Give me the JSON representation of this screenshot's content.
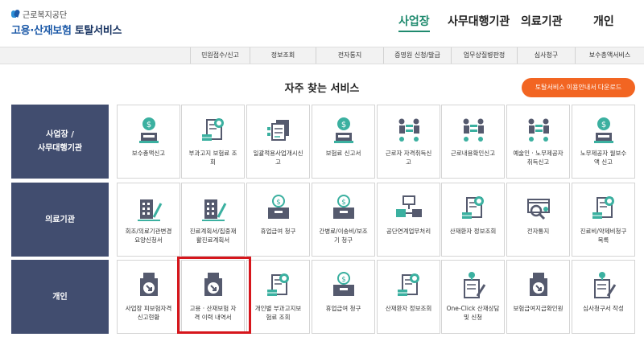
{
  "logo": {
    "org": "근로복지공단",
    "title_blue": "고용·산재보험",
    "title_dark": "토탈서비스"
  },
  "topnav": [
    "사업장",
    "사무대행기관",
    "의료기관",
    "개인"
  ],
  "subnav": [
    "민원접수/신고",
    "정보조회",
    "전자통지",
    "증명원 신청/발급",
    "업무상질병판정",
    "심사청구",
    "보수총액서비스"
  ],
  "section_title": "자주 찾는 서비스",
  "download_label": "토탈서비스 이용안내서 다운로드",
  "rows": [
    {
      "label": "사업장 /\n사무대행기관",
      "tiles": [
        {
          "icon": "money-person-icon",
          "label": "보수총액신고"
        },
        {
          "icon": "invoice-search-icon",
          "label": "부과고지 보험료 조\n회"
        },
        {
          "icon": "document-stack-icon",
          "label": "일괄적용사업개시신\n고"
        },
        {
          "icon": "money-person-icon",
          "label": "보험료 신고서"
        },
        {
          "icon": "people-flow-icon",
          "label": "근로자 자격취득신\n고"
        },
        {
          "icon": "people-flow-icon",
          "label": "근로내용확인신고"
        },
        {
          "icon": "people-flow-icon",
          "label": "예술인 · 노무제공자\n취득신고"
        },
        {
          "icon": "money-person-icon",
          "label": "노무제공자 월보수\n액 신고"
        }
      ]
    },
    {
      "label": "의료기관",
      "tiles": [
        {
          "icon": "building-pen-icon",
          "label": "회조/의료기관변경\n요양신청서"
        },
        {
          "icon": "building-pen-icon",
          "label": "진료계획서/집중재\n활진료계획서"
        },
        {
          "icon": "money-box-icon",
          "label": "휴업급여 청구"
        },
        {
          "icon": "money-box-icon",
          "label": "간병료/이송비/보조\n기 청구"
        },
        {
          "icon": "computer-link-icon",
          "label": "공단연계업무처리"
        },
        {
          "icon": "invoice-search-icon",
          "label": "산재환자 정보조회"
        },
        {
          "icon": "search-box-icon",
          "label": "전자통지"
        },
        {
          "icon": "invoice-search-icon",
          "label": "진료비/약제비청구\n목록"
        }
      ]
    },
    {
      "label": "개인",
      "tiles": [
        {
          "icon": "download-box-icon",
          "label": "사업장 피보험자격\n신고현황"
        },
        {
          "icon": "download-box-icon",
          "label": "고용 · 산재보험 자\n격 이력 내역서"
        },
        {
          "icon": "invoice-search-icon",
          "label": "개인별 부과고지보\n험료 조회"
        },
        {
          "icon": "money-box-icon",
          "label": "휴업급여 청구"
        },
        {
          "icon": "invoice-search-icon",
          "label": "산재환자 정보조회"
        },
        {
          "icon": "document-pen-icon",
          "label": "One-Click 산재상담\n및 신청"
        },
        {
          "icon": "download-box-icon",
          "label": "보험급여지급확인원"
        },
        {
          "icon": "document-pen-icon",
          "label": "심사청구서 작성"
        }
      ]
    }
  ],
  "colors": {
    "brand_blue": "#1d5aa8",
    "active_green": "#1f8a6e",
    "row_label_bg": "#414d6f",
    "button_orange": "#f26522",
    "highlight_red": "#d6161c",
    "icon_dark": "#555a6e",
    "icon_teal": "#3bb0a0"
  }
}
